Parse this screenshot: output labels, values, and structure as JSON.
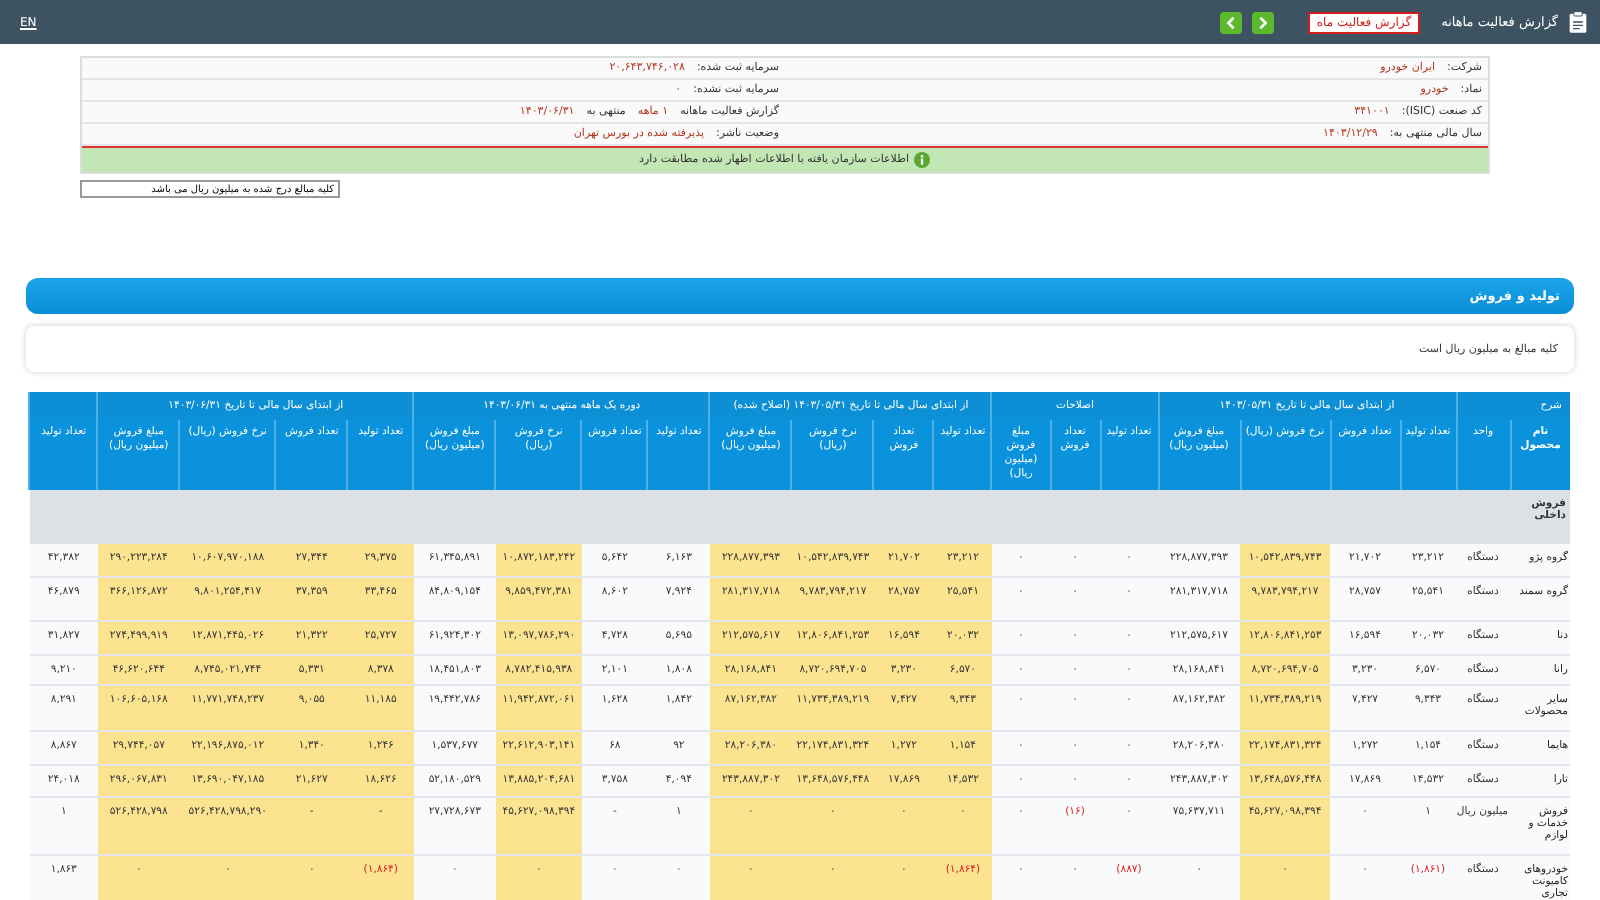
{
  "top_bar": {
    "title": "گزارش فعالیت ماهانه",
    "badge": "گزارش فعالیت ماه",
    "language": "EN"
  },
  "info": {
    "rows": [
      {
        "right": {
          "label": "شرکت:",
          "value": "ایران خودرو"
        },
        "left": [
          {
            "label": "سرمایه ثبت شده:",
            "value": "۲۰,۶۴۳,۷۴۶,۰۲۸"
          }
        ]
      },
      {
        "right": {
          "label": "نماد:",
          "value": "خودرو"
        },
        "left": [
          {
            "label": "سرمایه ثبت نشده:",
            "value": "۰"
          }
        ]
      },
      {
        "right": {
          "label": "کد صنعت (ISIC):",
          "value": "۳۴۱۰۰۱"
        },
        "left": [
          {
            "label": "گزارش فعالیت ماهانه",
            "value": "۱ ماهه"
          },
          {
            "label": "منتهی به",
            "value": "۱۴۰۳/۰۶/۳۱"
          }
        ]
      },
      {
        "right": {
          "label": "سال مالی منتهی به:",
          "value": "۱۴۰۳/۱۲/۲۹"
        },
        "left": [
          {
            "label": "وضعیت ناشر:",
            "value": "پذیرفته شده در بورس تهران"
          }
        ]
      }
    ],
    "notice": "اطلاعات سازمان یافته با اطلاعات اظهار شده مطابقت دارد"
  },
  "amount_field": {
    "value": "کلیه مبالغ درج شده به میلیون ریال می باشد"
  },
  "section": {
    "title": "تولید و فروش",
    "note": "کلیه مبالغ به میلیون ریال است"
  },
  "table": {
    "groups": [
      {
        "label": "شرح",
        "columns": [
          {
            "label": "نام محصول",
            "highlighted": false
          },
          {
            "label": "واحد",
            "highlighted": false
          }
        ]
      },
      {
        "label": "از ابتدای سال مالی تا تاریخ ۱۴۰۳/۰۵/۳۱",
        "columns": [
          {
            "label": "تعداد تولید",
            "highlighted": false
          },
          {
            "label": "تعداد فروش",
            "highlighted": false
          },
          {
            "label": "نرخ فروش (ریال)",
            "highlighted": true
          },
          {
            "label": "مبلغ فروش (میلیون ریال)",
            "highlighted": false
          }
        ]
      },
      {
        "label": "اصلاحات",
        "columns": [
          {
            "label": "تعداد تولید",
            "highlighted": false
          },
          {
            "label": "تعداد فروش",
            "highlighted": false
          },
          {
            "label": "مبلغ فروش (میلیون ریال)",
            "highlighted": false
          }
        ]
      },
      {
        "label": "از ابتدای سال مالی تا تاریخ ۱۴۰۳/۰۵/۳۱ (اصلاح شده)",
        "columns": [
          {
            "label": "تعداد تولید",
            "highlighted": true
          },
          {
            "label": "تعداد فروش",
            "highlighted": true
          },
          {
            "label": "نرخ فروش (ریال)",
            "highlighted": true
          },
          {
            "label": "مبلغ فروش (میلیون ریال)",
            "highlighted": true
          }
        ]
      },
      {
        "label": "دوره یک ماهه منتهی به ۱۴۰۳/۰۶/۳۱",
        "columns": [
          {
            "label": "تعداد تولید",
            "highlighted": false
          },
          {
            "label": "تعداد فروش",
            "highlighted": false
          },
          {
            "label": "نرخ فروش (ریال)",
            "highlighted": true
          },
          {
            "label": "مبلغ فروش (میلیون ریال)",
            "highlighted": false
          }
        ]
      },
      {
        "label": "از ابتدای سال مالی تا تاریخ ۱۴۰۳/۰۶/۳۱",
        "columns": [
          {
            "label": "تعداد تولید",
            "highlighted": true
          },
          {
            "label": "تعداد فروش",
            "highlighted": true
          },
          {
            "label": "نرخ فروش (ریال)",
            "highlighted": true
          },
          {
            "label": "مبلغ فروش (میلیون ریال)",
            "highlighted": true
          }
        ]
      },
      {
        "columns": [
          {
            "label": "تعداد تولید",
            "highlighted": false
          }
        ]
      }
    ],
    "rows": [
      {
        "kind": "section",
        "name": "فروش داخلی"
      },
      {
        "kind": "item",
        "name": "گروه پژو",
        "unit": "دستگاه",
        "cells": [
          "۲۳,۲۱۲",
          "۲۱,۷۰۲",
          "۱۰,۵۴۲,۸۳۹,۷۴۳",
          "۲۲۸,۸۷۷,۳۹۳",
          "۰",
          "۰",
          "۰",
          "۲۳,۲۱۲",
          "۲۱,۷۰۲",
          "۱۰,۵۴۲,۸۳۹,۷۴۳",
          "۲۲۸,۸۷۷,۳۹۳",
          "۶,۱۶۳",
          "۵,۶۴۲",
          "۱۰,۸۷۲,۱۸۳,۲۴۲",
          "۶۱,۳۴۵,۸۹۱",
          "۲۹,۳۷۵",
          "۲۷,۳۴۴",
          "۱۰,۶۰۷,۹۷۰,۱۸۸",
          "۲۹۰,۲۲۳,۲۸۴",
          "۴۲,۳۸۲"
        ],
        "negative": [
          false,
          false,
          false,
          false,
          false,
          false,
          false,
          false,
          false,
          false,
          false,
          false,
          false,
          false,
          false,
          false,
          false,
          false,
          false,
          false
        ]
      },
      {
        "kind": "item",
        "name": "گروه سمند",
        "unit": "دستگاه",
        "cells": [
          "۲۵,۵۴۱",
          "۲۸,۷۵۷",
          "۹,۷۸۳,۷۹۴,۲۱۷",
          "۲۸۱,۳۱۷,۷۱۸",
          "۰",
          "۰",
          "۰",
          "۲۵,۵۴۱",
          "۲۸,۷۵۷",
          "۹,۷۸۳,۷۹۴,۲۱۷",
          "۲۸۱,۳۱۷,۷۱۸",
          "۷,۹۲۴",
          "۸,۶۰۲",
          "۹,۸۵۹,۴۷۲,۳۸۱",
          "۸۴,۸۰۹,۱۵۴",
          "۳۳,۴۶۵",
          "۳۷,۳۵۹",
          "۹,۸۰۱,۲۵۴,۴۱۷",
          "۳۶۶,۱۲۶,۸۷۲",
          "۴۶,۸۷۹"
        ],
        "negative": [
          false,
          false,
          false,
          false,
          false,
          false,
          false,
          false,
          false,
          false,
          false,
          false,
          false,
          false,
          false,
          false,
          false,
          false,
          false,
          false
        ]
      },
      {
        "kind": "item",
        "name": "دنا",
        "unit": "دستگاه",
        "cells": [
          "۲۰,۰۳۲",
          "۱۶,۵۹۴",
          "۱۲,۸۰۶,۸۴۱,۲۵۳",
          "۲۱۲,۵۷۵,۶۱۷",
          "۰",
          "۰",
          "۰",
          "۲۰,۰۳۲",
          "۱۶,۵۹۴",
          "۱۲,۸۰۶,۸۴۱,۲۵۳",
          "۲۱۲,۵۷۵,۶۱۷",
          "۵,۶۹۵",
          "۴,۷۲۸",
          "۱۳,۰۹۷,۷۸۶,۲۹۰",
          "۶۱,۹۲۴,۳۰۲",
          "۲۵,۷۲۷",
          "۲۱,۳۲۲",
          "۱۲,۸۷۱,۴۴۵,۰۲۶",
          "۲۷۴,۴۹۹,۹۱۹",
          "۳۱,۸۲۷"
        ],
        "negative": [
          false,
          false,
          false,
          false,
          false,
          false,
          false,
          false,
          false,
          false,
          false,
          false,
          false,
          false,
          false,
          false,
          false,
          false,
          false,
          false
        ]
      },
      {
        "kind": "item",
        "name": "رانا",
        "unit": "دستگاه",
        "cells": [
          "۶,۵۷۰",
          "۳,۲۳۰",
          "۸,۷۲۰,۶۹۴,۷۰۵",
          "۲۸,۱۶۸,۸۴۱",
          "۰",
          "۰",
          "۰",
          "۶,۵۷۰",
          "۳,۲۳۰",
          "۸,۷۲۰,۶۹۴,۷۰۵",
          "۲۸,۱۶۸,۸۴۱",
          "۱,۸۰۸",
          "۲,۱۰۱",
          "۸,۷۸۲,۴۱۵,۹۳۸",
          "۱۸,۴۵۱,۸۰۳",
          "۸,۳۷۸",
          "۵,۳۳۱",
          "۸,۷۴۵,۰۲۱,۷۴۴",
          "۴۶,۶۲۰,۶۴۴",
          "۹,۲۱۰"
        ],
        "negative": [
          false,
          false,
          false,
          false,
          false,
          false,
          false,
          false,
          false,
          false,
          false,
          false,
          false,
          false,
          false,
          false,
          false,
          false,
          false,
          false
        ]
      },
      {
        "kind": "item",
        "name": "سایر محصولات",
        "unit": "دستگاه",
        "cells": [
          "۹,۳۴۳",
          "۷,۴۲۷",
          "۱۱,۷۳۴,۳۸۹,۲۱۹",
          "۸۷,۱۶۲,۳۸۲",
          "۰",
          "۰",
          "۰",
          "۹,۳۴۳",
          "۷,۴۲۷",
          "۱۱,۷۳۴,۳۸۹,۲۱۹",
          "۸۷,۱۶۲,۳۸۲",
          "۱,۸۴۲",
          "۱,۶۲۸",
          "۱۱,۹۴۲,۸۷۲,۰۶۱",
          "۱۹,۴۴۲,۷۸۶",
          "۱۱,۱۸۵",
          "۹,۰۵۵",
          "۱۱,۷۷۱,۷۴۸,۲۳۷",
          "۱۰۶,۶۰۵,۱۶۸",
          "۸,۲۹۱"
        ],
        "negative": [
          false,
          false,
          false,
          false,
          false,
          false,
          false,
          false,
          false,
          false,
          false,
          false,
          false,
          false,
          false,
          false,
          false,
          false,
          false,
          false
        ]
      },
      {
        "kind": "item",
        "name": "هایما",
        "unit": "دستگاه",
        "cells": [
          "۱,۱۵۴",
          "۱,۲۷۲",
          "۲۲,۱۷۴,۸۳۱,۳۲۴",
          "۲۸,۲۰۶,۳۸۰",
          "۰",
          "۰",
          "۰",
          "۱,۱۵۴",
          "۱,۲۷۲",
          "۲۲,۱۷۴,۸۳۱,۳۲۴",
          "۲۸,۲۰۶,۳۸۰",
          "۹۲",
          "۶۸",
          "۲۲,۶۱۲,۹۰۳,۱۴۱",
          "۱,۵۳۷,۶۷۷",
          "۱,۲۴۶",
          "۱,۳۴۰",
          "۲۲,۱۹۶,۸۷۵,۰۱۲",
          "۲۹,۷۴۴,۰۵۷",
          "۸,۸۶۷"
        ],
        "negative": [
          false,
          false,
          false,
          false,
          false,
          false,
          false,
          false,
          false,
          false,
          false,
          false,
          false,
          false,
          false,
          false,
          false,
          false,
          false,
          false
        ]
      },
      {
        "kind": "item",
        "name": "تارا",
        "unit": "دستگاه",
        "cells": [
          "۱۴,۵۳۲",
          "۱۷,۸۶۹",
          "۱۳,۶۴۸,۵۷۶,۴۴۸",
          "۲۴۳,۸۸۷,۳۰۲",
          "۰",
          "۰",
          "۰",
          "۱۴,۵۳۲",
          "۱۷,۸۶۹",
          "۱۳,۶۴۸,۵۷۶,۴۴۸",
          "۲۴۳,۸۸۷,۳۰۲",
          "۴,۰۹۴",
          "۳,۷۵۸",
          "۱۳,۸۸۵,۲۰۴,۶۸۱",
          "۵۲,۱۸۰,۵۲۹",
          "۱۸,۶۲۶",
          "۲۱,۶۲۷",
          "۱۳,۶۹۰,۰۴۷,۱۸۵",
          "۲۹۶,۰۶۷,۸۳۱",
          "۲۴,۰۱۸"
        ],
        "negative": [
          false,
          false,
          false,
          false,
          false,
          false,
          false,
          false,
          false,
          false,
          false,
          false,
          false,
          false,
          false,
          false,
          false,
          false,
          false,
          false
        ]
      },
      {
        "kind": "item",
        "name": "فروش خدمات و لوازم",
        "unit": "میلیون ریال",
        "cells": [
          "۱",
          "۰",
          "۴۵,۶۲۷,۰۹۸,۳۹۴",
          "۷۵,۶۳۷,۷۱۱",
          "۰",
          "(۱۶)",
          "۰",
          "۰",
          "۰",
          "۰",
          "۰",
          "۱",
          "-",
          "۴۵,۶۲۷,۰۹۸,۳۹۴",
          "۲۷,۷۲۸,۶۷۳",
          "-",
          "-",
          "۵۲۶,۴۲۸,۷۹۸,۲۹۰",
          "۵۲۶,۴۲۸,۷۹۸",
          "۱"
        ],
        "negative": [
          false,
          false,
          false,
          false,
          false,
          true,
          false,
          false,
          false,
          false,
          false,
          false,
          false,
          false,
          false,
          false,
          false,
          false,
          false,
          false
        ]
      },
      {
        "kind": "item",
        "name": "خودروهای کامیونت تجاری",
        "unit": "دستگاه",
        "cells": [
          "(۱,۸۶۱)",
          "۰",
          "۰",
          "۰",
          "(۸۸۷)",
          "۰",
          "۰",
          "(۱,۸۶۴)",
          "۰",
          "۰",
          "۰",
          "۰",
          "۰",
          "۰",
          "۰",
          "(۱,۸۶۴)",
          "۰",
          "۰",
          "۰",
          "۱,۸۶۳"
        ],
        "negative": [
          true,
          false,
          false,
          false,
          true,
          false,
          false,
          true,
          false,
          false,
          false,
          false,
          false,
          false,
          false,
          true,
          false,
          false,
          false,
          false
        ]
      }
    ]
  }
}
